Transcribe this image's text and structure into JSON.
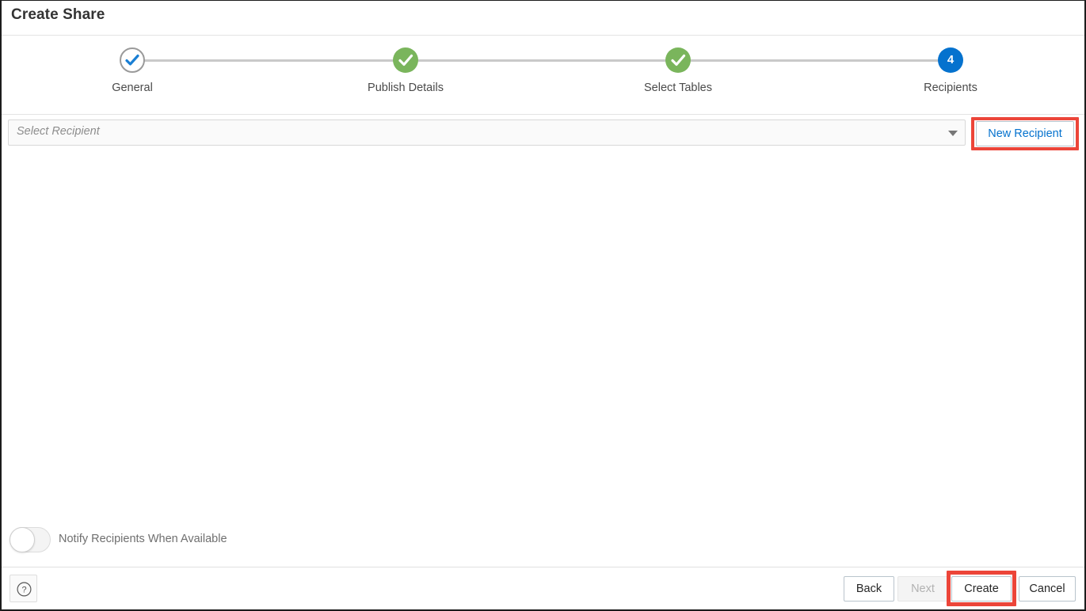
{
  "window": {
    "title": "Create Share"
  },
  "stepper": {
    "steps": [
      {
        "label": "General",
        "state": "visited",
        "indicator": "check"
      },
      {
        "label": "Publish Details",
        "state": "done",
        "indicator": "check"
      },
      {
        "label": "Select Tables",
        "state": "done",
        "indicator": "check"
      },
      {
        "label": "Recipients",
        "state": "active",
        "indicator": "4"
      }
    ]
  },
  "recipient": {
    "placeholder": "Select Recipient",
    "value": "",
    "new_recipient_label": "New Recipient"
  },
  "notify": {
    "label": "Notify Recipients When Available",
    "state": "off"
  },
  "footer": {
    "help_label": "?",
    "back_label": "Back",
    "next_label": "Next",
    "create_label": "Create",
    "cancel_label": "Cancel"
  },
  "colors": {
    "accent_blue": "#0572ce",
    "done_green": "#7ab55c",
    "highlight_red": "#ec4539",
    "track_gray": "#c9c9c9",
    "text_dark": "#333333",
    "text_muted": "#6f6f6f"
  }
}
